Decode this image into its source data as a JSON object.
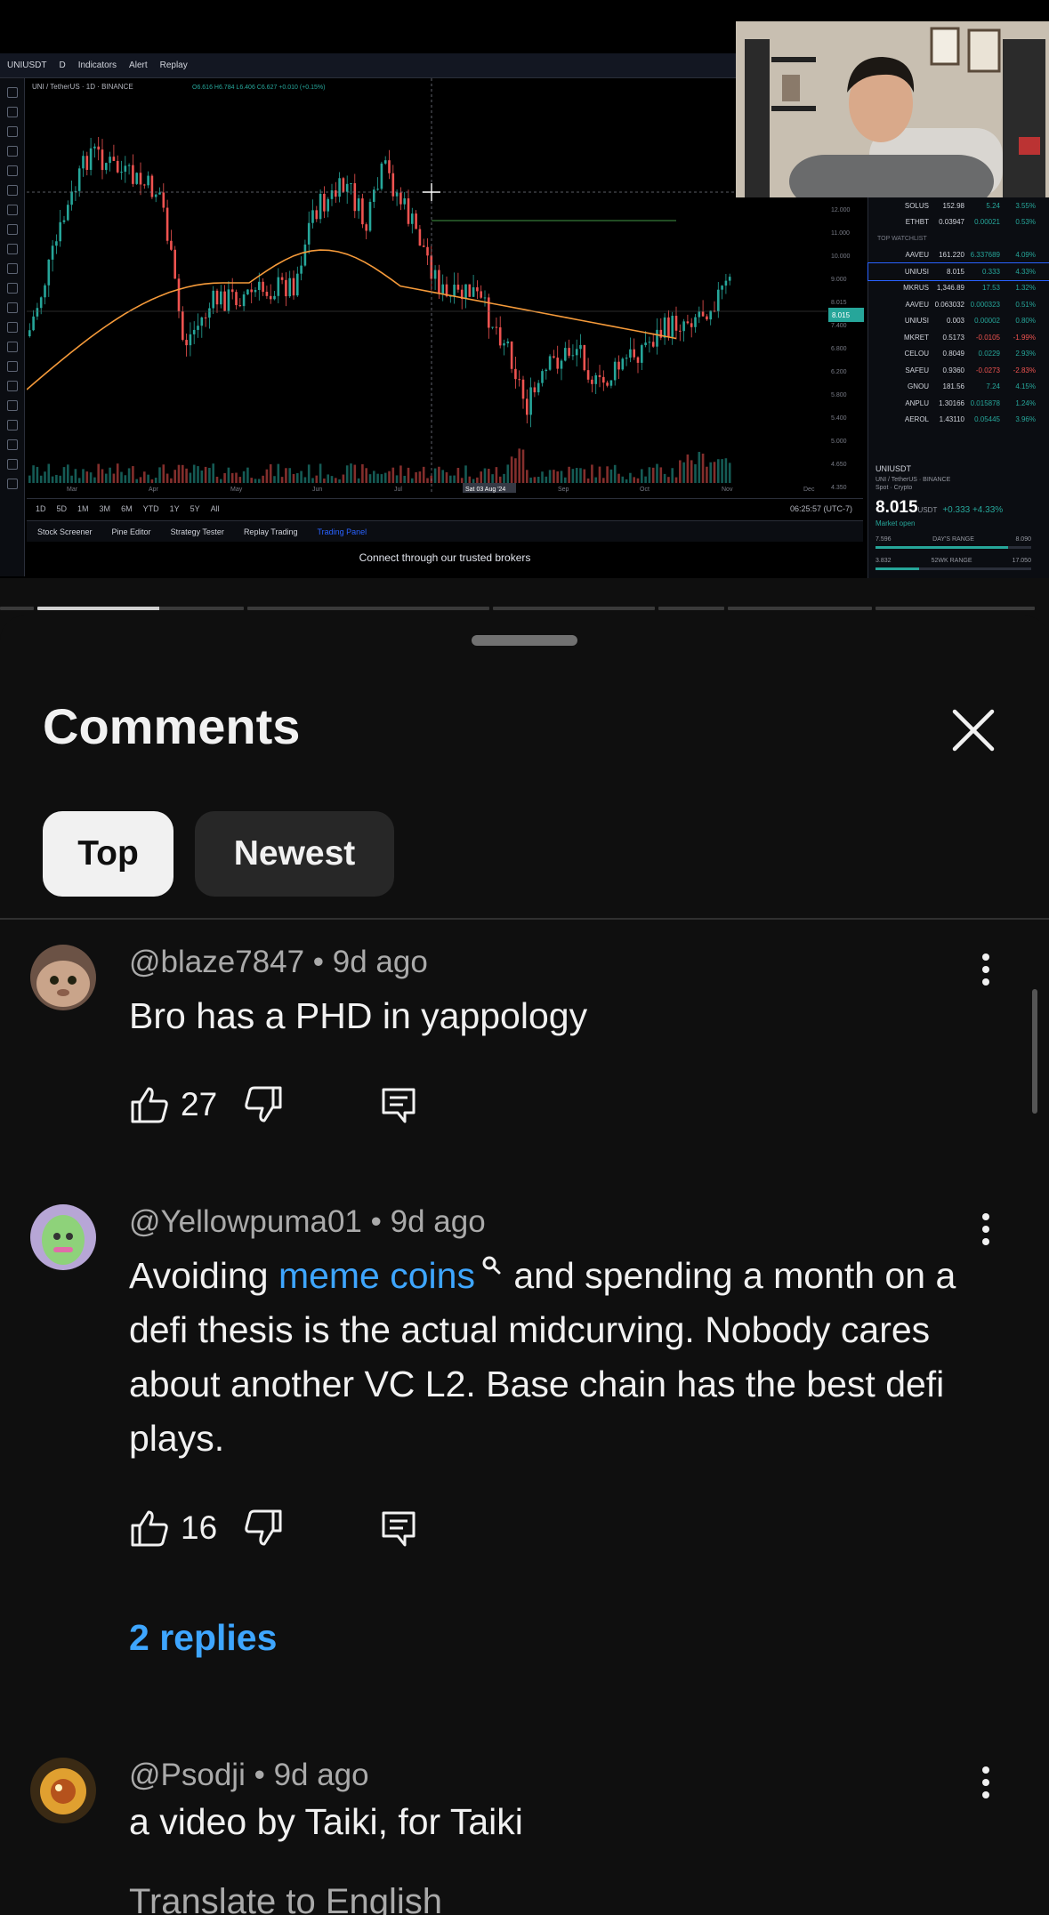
{
  "video": {
    "toolbar": [
      "UNIUSDT",
      "D",
      "Indicators",
      "Alert",
      "Replay"
    ],
    "chart_info": "UNI / TetherUS · 1D · BINANCE",
    "ohlc": "O6.616 H6.784 L6.406 C6.627 +0.010 (+0.15%)",
    "crosshair_date": "Sat 03 Aug '24",
    "months": [
      "Mar",
      "Apr",
      "May",
      "Jun",
      "Jul",
      "Aug",
      "Sep",
      "Oct",
      "Nov",
      "Dec"
    ],
    "price_axis": [
      "12.000",
      "11.000",
      "10.000",
      "9.000",
      "8.015",
      "7.400",
      "6.800",
      "6.200",
      "5.800",
      "5.400",
      "5.000",
      "4.650",
      "4.350"
    ],
    "ranges": [
      "1D",
      "5D",
      "1M",
      "3M",
      "6M",
      "YTD",
      "1Y",
      "5Y",
      "All"
    ],
    "clock": "06:25:57 (UTC-7)",
    "panels": [
      "Stock Screener",
      "Pine Editor",
      "Strategy Tester",
      "Replay Trading",
      "Trading Panel"
    ],
    "connect": "Connect through our trusted brokers",
    "watchlist": [
      {
        "sym": "SOLUS",
        "last": "152.98",
        "chg": "5.24",
        "pct": "3.55%",
        "dir": "up"
      },
      {
        "sym": "ETHBT",
        "last": "0.03947",
        "chg": "0.00021",
        "pct": "0.53%",
        "dir": "up"
      },
      {
        "sym": "TOP WATCHLIST",
        "last": "",
        "chg": "",
        "pct": "",
        "dir": "hdr"
      },
      {
        "sym": "AAVEU",
        "last": "161.220",
        "chg": "6.337689",
        "pct": "4.09%",
        "dir": "up"
      },
      {
        "sym": "UNIUSI",
        "last": "8.015",
        "chg": "0.333",
        "pct": "4.33%",
        "dir": "up"
      },
      {
        "sym": "MKRUS",
        "last": "1,346.89",
        "chg": "17.53",
        "pct": "1.32%",
        "dir": "up"
      },
      {
        "sym": "AAVEU",
        "last": "0.063032",
        "chg": "0.000323",
        "pct": "0.51%",
        "dir": "up"
      },
      {
        "sym": "UNIUSI",
        "last": "0.003",
        "chg": "0.00002",
        "pct": "0.80%",
        "dir": "up"
      },
      {
        "sym": "MKRET",
        "last": "0.5173",
        "chg": "-0.0105",
        "pct": "-1.99%",
        "dir": "dn"
      },
      {
        "sym": "CELOU",
        "last": "0.8049",
        "chg": "0.0229",
        "pct": "2.93%",
        "dir": "up"
      },
      {
        "sym": "SAFEU",
        "last": "0.9360",
        "chg": "-0.0273",
        "pct": "-2.83%",
        "dir": "dn"
      },
      {
        "sym": "GNOU",
        "last": "181.56",
        "chg": "7.24",
        "pct": "4.15%",
        "dir": "up"
      },
      {
        "sym": "ANPLU",
        "last": "1.30166",
        "chg": "0.015878",
        "pct": "1.24%",
        "dir": "up"
      },
      {
        "sym": "AEROL",
        "last": "1.43110",
        "chg": "0.05445",
        "pct": "3.96%",
        "dir": "up"
      }
    ],
    "quote": {
      "symbol": "UNIUSDT",
      "name": "UNI / TetherUS · BINANCE",
      "type": "Spot · Crypto",
      "price": "8.015",
      "unit": "USDT",
      "change": "+0.333 +4.33%",
      "status": "Market open",
      "days_low": "7.596",
      "days_label": "DAY'S RANGE",
      "days_high": "8.090",
      "wk_low": "3.832",
      "wk_label": "52WK RANGE",
      "wk_high": "17.050"
    }
  },
  "comments_sheet": {
    "title": "Comments",
    "close_label": "Close",
    "tabs": [
      {
        "label": "Top",
        "selected": true
      },
      {
        "label": "Newest",
        "selected": false
      }
    ],
    "comments": [
      {
        "author": "@blaze7847",
        "age": "9d ago",
        "text": "Bro has a PHD in yappology",
        "likes": "27"
      },
      {
        "author": "@Yellowpuma01",
        "age": "9d ago",
        "text_link": "meme coins",
        "text_pre": "Avoiding ",
        "text_post": " and spending a month on a defi thesis is the actual midcurving. Nobody cares about another VC L2. Base chain has the best defi plays.",
        "likes": "16",
        "replies": "2 replies"
      },
      {
        "author": "@Psodji",
        "age": "9d ago",
        "text": "a video by Taiki, for Taiki",
        "translate": "Translate to English"
      }
    ],
    "separator": " • "
  },
  "colors": {
    "sheet_bg": "#0f0f0f",
    "chip_selected_bg": "#f1f1f1",
    "chip_bg": "#272727",
    "link": "#3ea6ff",
    "secondary_text": "#aaaaaa",
    "candle_up": "#26a69a",
    "candle_down": "#ef5350",
    "ma_line": "#f59a3a"
  }
}
